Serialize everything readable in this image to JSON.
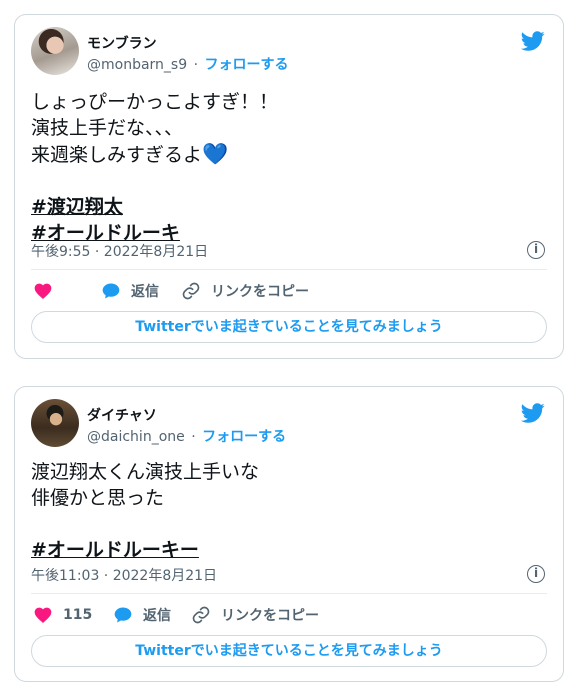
{
  "colors": {
    "twitter_blue": "#1d9bf0",
    "like_red": "#f91880",
    "text_primary": "#0f1419",
    "text_secondary": "#536471",
    "border": "#cfd9de"
  },
  "tweets": [
    {
      "display_name": "モンブラン",
      "handle": "@monbarn_s9",
      "separator": "·",
      "follow_label": "フォローする",
      "lines": [
        "しょっぴーかっこよすぎ！！",
        "演技上手だな、、、",
        "来週楽しみすぎるよ"
      ],
      "emoji": "💙",
      "hashtags": [
        "#渡辺翔太",
        "#オールドルーキ"
      ],
      "timestamp": "午後9:55 · 2022年8月21日",
      "like_count": "",
      "reply_label": "返信",
      "copy_link_label": "リンクをコピー",
      "cta_label": "Twitterでいま起きていることを見てみましょう"
    },
    {
      "display_name": "ダイチャソ",
      "handle": "@daichin_one",
      "separator": "·",
      "follow_label": "フォローする",
      "lines": [
        "渡辺翔太くん演技上手いな",
        "俳優かと思った"
      ],
      "hashtags": [
        "#オールドルーキー"
      ],
      "timestamp": "午後11:03 · 2022年8月21日",
      "like_count": "115",
      "reply_label": "返信",
      "copy_link_label": "リンクをコピー",
      "cta_label": "Twitterでいま起きていることを見てみましょう"
    }
  ],
  "icons": {
    "brand": "twitter-bird-icon",
    "like": "heart-icon",
    "reply": "speech-bubble-icon",
    "copy": "link-icon",
    "info": "info-icon"
  }
}
